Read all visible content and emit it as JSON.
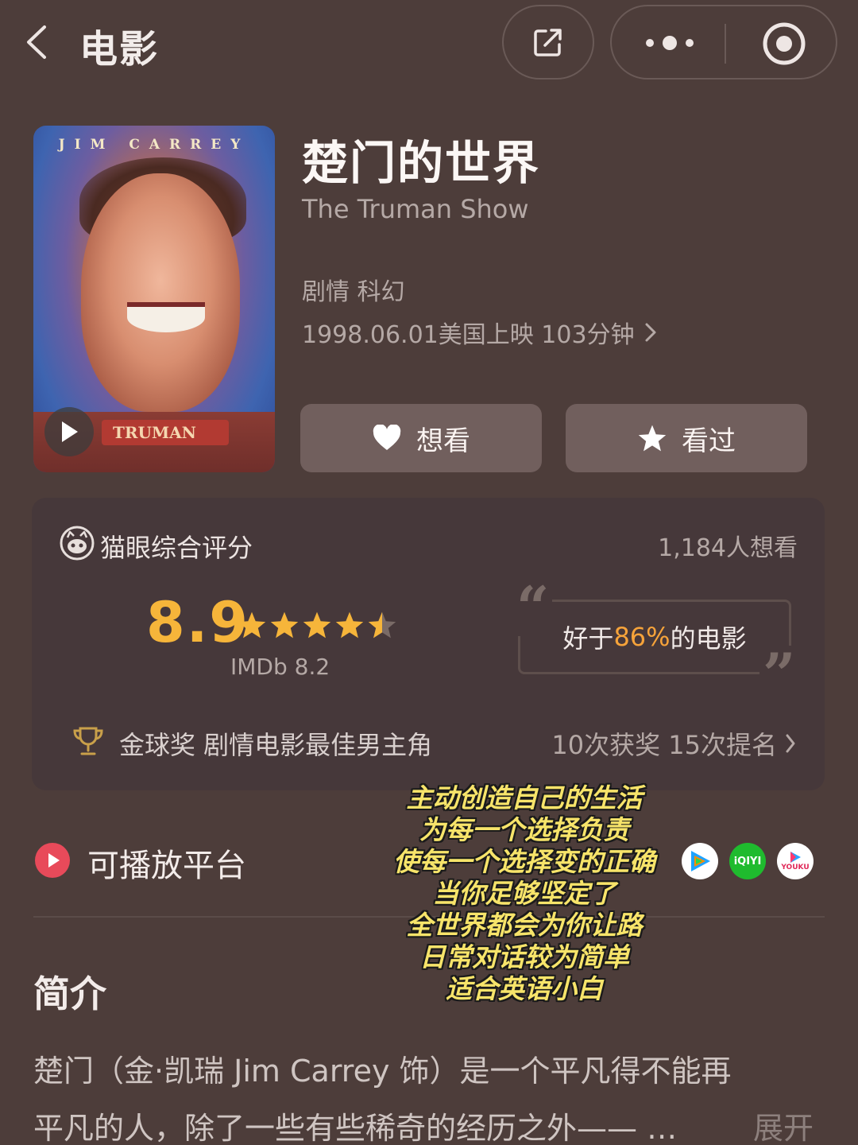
{
  "header": {
    "title": "电影"
  },
  "movie": {
    "title_cn": "楚门的世界",
    "title_en": "The Truman Show",
    "genre": "剧情 科幻",
    "release": "1998.06.01美国上映 103分钟",
    "poster": {
      "actor": "JIM CARREY",
      "banner": "TRUMAN"
    }
  },
  "actions": {
    "want": "想看",
    "seen": "看过"
  },
  "rating": {
    "label": "猫眼综合评分",
    "want_count": "1,184人想看",
    "score": "8.9",
    "stars": 4.5,
    "imdb": "IMDb 8.2",
    "better_than_prefix": "好于",
    "better_than_pct": "86%",
    "better_than_suffix": "的电影",
    "award": "金球奖 剧情电影最佳男主角",
    "award_count": "10次获奖 15次提名",
    "accent_color": "#f6b53a"
  },
  "platforms": {
    "label": "可播放平台",
    "items": [
      "tencent-video-icon",
      "iqiyi-icon",
      "youku-icon"
    ],
    "iqiyi_text": "iQIYI",
    "youku_text": "YOUKU"
  },
  "overlay_caption": [
    "主动创造自己的生活",
    "为每一个选择负责",
    "使每一个选择变的正确",
    "当你足够坚定了",
    "全世界都会为你让路",
    "日常对话较为简单",
    "适合英语小白"
  ],
  "synopsis": {
    "title": "简介",
    "line1": "楚门（金·凯瑞 Jim Carrey 饰）是一个平凡得不能再",
    "line2": "平凡的人，除了一些有些稀奇的经历之外—— …",
    "expand": "展开"
  }
}
